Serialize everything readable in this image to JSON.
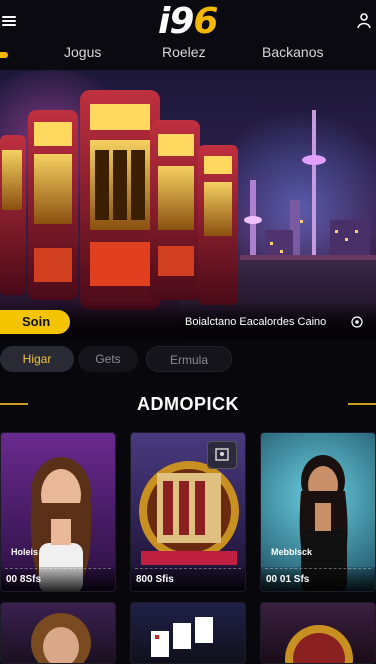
{
  "brand": {
    "logo_part1": "i9",
    "logo_part2": "6"
  },
  "nav": {
    "items": [
      "Jogus",
      "Roelez",
      "Backanos"
    ]
  },
  "hero": {
    "spin_label": "Soin",
    "caption": "Boialctano Eacalordes Caino"
  },
  "filters": [
    "Higar",
    "Gets",
    "Ermula"
  ],
  "section": {
    "title": "ADMOPICK"
  },
  "cards": [
    {
      "label": "Holeis",
      "amount": "00 8Sfs"
    },
    {
      "label": "",
      "amount": "800 Sfis"
    },
    {
      "label": "Mebblsck",
      "amount": "00 01 Sfs"
    }
  ],
  "colors": {
    "accent": "#f5c400",
    "background": "#07070c"
  },
  "icons": [
    "menu-icon",
    "user-icon",
    "info-icon",
    "video-icon"
  ]
}
